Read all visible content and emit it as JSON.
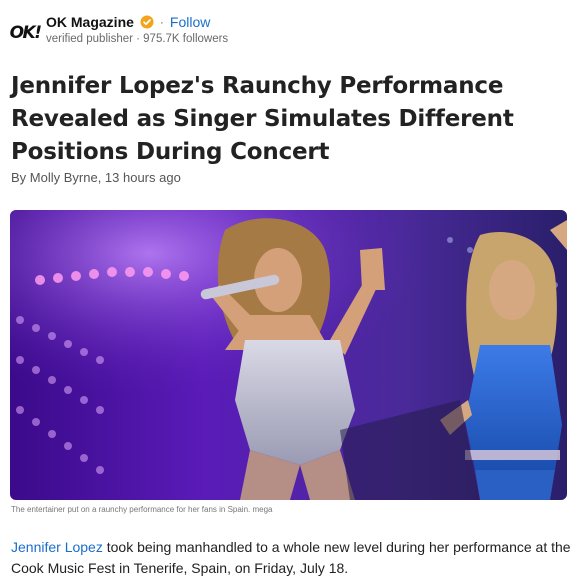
{
  "publisher": {
    "logo_text": "OK!",
    "name": "OK Magazine",
    "follow_label": "Follow",
    "separator": "·",
    "subtitle": "verified publisher · 975.7K followers"
  },
  "article": {
    "headline": "Jennifer Lopez's Raunchy Performance Revealed as Singer Simulates Different Positions During Concert",
    "byline": "By Molly Byrne, 13 hours ago",
    "image_caption": "The entertainer put on a raunchy performance for her fans in Spain. mega",
    "body_link": "Jennifer Lopez",
    "body_rest": " took being manhandled to a whole new level during her performance at the Cook Music Fest in Tenerife, Spain, on Friday, July 18."
  },
  "colors": {
    "accent": "#1a6fc9",
    "verified_badge": "#f2a51a"
  }
}
